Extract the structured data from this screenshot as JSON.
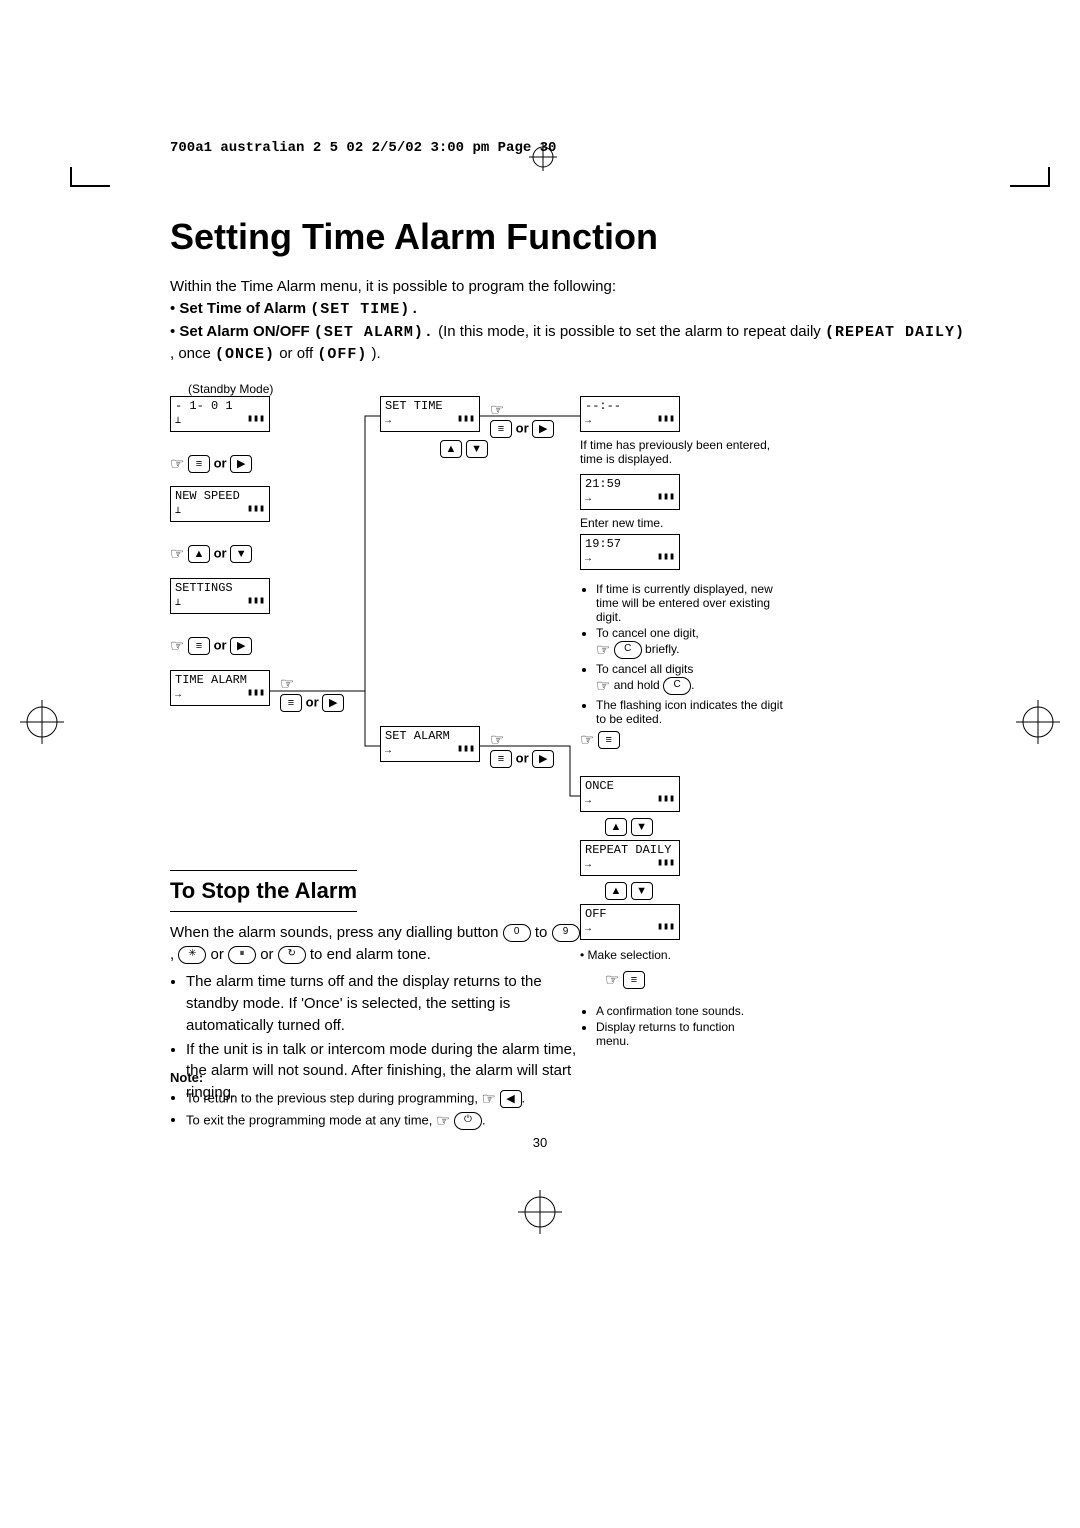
{
  "header": "700a1  australian 2 5 02  2/5/02  3:00 pm  Page 30",
  "title": "Setting Time Alarm Function",
  "intro_line": "Within the Time Alarm menu, it is possible to program the following:",
  "bullet1_label": "Set Time of Alarm",
  "bullet1_code": "(SET TIME).",
  "bullet2_label": "Set Alarm ON/OFF",
  "bullet2_code": "(SET ALARM).",
  "bullet2_rest": " (In this mode, it is possible to set the alarm to repeat daily ",
  "bullet2_rep": "(REPEAT DAILY)",
  "bullet2_mid": ", once ",
  "bullet2_once": "(ONCE)",
  "bullet2_mid2": " or off ",
  "bullet2_off": "(OFF)",
  "bullet2_end": ").",
  "standby_label": "(Standby Mode)",
  "box_standby": "- 1-      0 1",
  "box_newspeed": "NEW SPEED",
  "box_settings": "SETTINGS",
  "box_timealarm": "TIME ALARM",
  "box_settime": "SET TIME",
  "box_setalarm": "SET ALARM",
  "box_dash": "--:--",
  "box_2159": "21:59",
  "box_1957": "19:57",
  "box_once": "ONCE",
  "box_repeat": "REPEAT DAILY",
  "box_off": "OFF",
  "note_prev": "If time has previously been entered, time is displayed.",
  "note_enter": "Enter new time.",
  "right_b1": "If time is currently displayed, new time will be entered over existing digit.",
  "right_b2": "To cancel one digit,",
  "right_b2_after": "briefly.",
  "right_b3": "To cancel all digits",
  "right_b3_after": "and hold",
  "right_b4": "The flashing icon indicates the digit to be edited.",
  "make_sel": "Make selection.",
  "conf1": "A confirmation tone sounds.",
  "conf2": "Display returns to function menu.",
  "or": "or",
  "stop_title": "To Stop the Alarm",
  "stop_p1a": "When the alarm sounds, press any dialling button ",
  "stop_p1b": " to ",
  "stop_p1c": " or ",
  "stop_p1d": " to end alarm tone.",
  "stop_li1": "The alarm time turns off and the display returns to the standby mode. If 'Once' is selected, the setting is automatically turned off.",
  "stop_li2": "If the unit is in talk or intercom mode during the alarm time, the alarm will not sound. After finishing, the alarm will start ringing.",
  "note_title": "Note:",
  "note1": "To return to the previous step during programming, ",
  "note2": "To exit the programming mode at any time, ",
  "pagenum": "30"
}
